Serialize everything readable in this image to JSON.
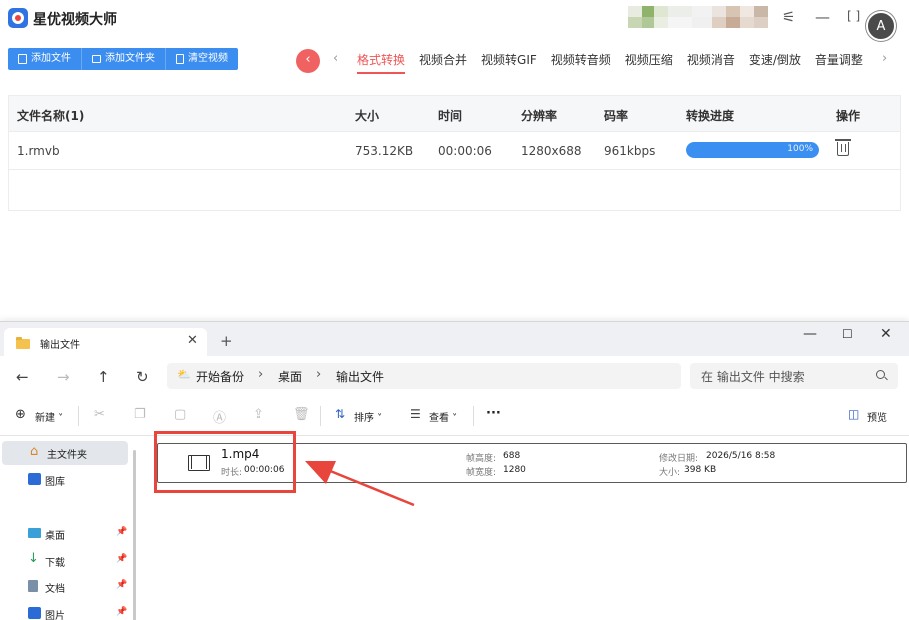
{
  "app": {
    "title": "星优视频大师",
    "toolbar": {
      "add_file": "添加文件",
      "add_folder": "添加文件夹",
      "clear": "清空视频"
    },
    "tabs": [
      "格式转换",
      "视频合并",
      "视频转GIF",
      "视频转音频",
      "视频压缩",
      "视频消音",
      "变速/倒放",
      "音量调整"
    ],
    "active_tab": "格式转换",
    "table": {
      "headers": {
        "name": "文件名称(1)",
        "size": "大小",
        "time": "时间",
        "resolution": "分辨率",
        "bitrate": "码率",
        "progress": "转换进度",
        "action": "操作"
      },
      "rows": [
        {
          "name": "1.rmvb",
          "size": "753.12KB",
          "time": "00:00:06",
          "resolution": "1280x688",
          "bitrate": "961kbps",
          "progress": 100,
          "progress_label": "100%"
        }
      ]
    },
    "colors": {
      "accent": "#3b8df0",
      "active_tab": "#ef5555",
      "progress": "#3a8ff0"
    }
  },
  "explorer": {
    "tab_title": "输出文件",
    "breadcrumb": [
      "开始备份",
      "桌面",
      "输出文件"
    ],
    "search_placeholder": "在 输出文件 中搜索",
    "commands": {
      "new": "新建",
      "sort": "排序",
      "view": "查看",
      "more": "···",
      "preview": "预览"
    },
    "sidebar": [
      {
        "label": "主文件夹",
        "icon": "home-icon",
        "pinned": false,
        "selected": true
      },
      {
        "label": "图库",
        "icon": "gallery-icon",
        "pinned": false,
        "selected": false
      },
      {
        "label": "桌面",
        "icon": "desktop-icon",
        "pinned": true,
        "selected": false
      },
      {
        "label": "下载",
        "icon": "download-icon",
        "pinned": true,
        "selected": false
      },
      {
        "label": "文档",
        "icon": "document-icon",
        "pinned": true,
        "selected": false
      },
      {
        "label": "图片",
        "icon": "pictures-icon",
        "pinned": true,
        "selected": false
      }
    ],
    "file": {
      "name": "1.mp4",
      "duration_label": "时长:",
      "duration": "00:00:06",
      "height_label": "帧高度:",
      "height": "688",
      "width_label": "帧宽度:",
      "width": "1280",
      "modified_label": "修改日期:",
      "modified": "2026/5/16 8:58",
      "size_label": "大小:",
      "size": "398 KB"
    }
  },
  "annotation": {
    "highlight_color": "#e8453c"
  }
}
